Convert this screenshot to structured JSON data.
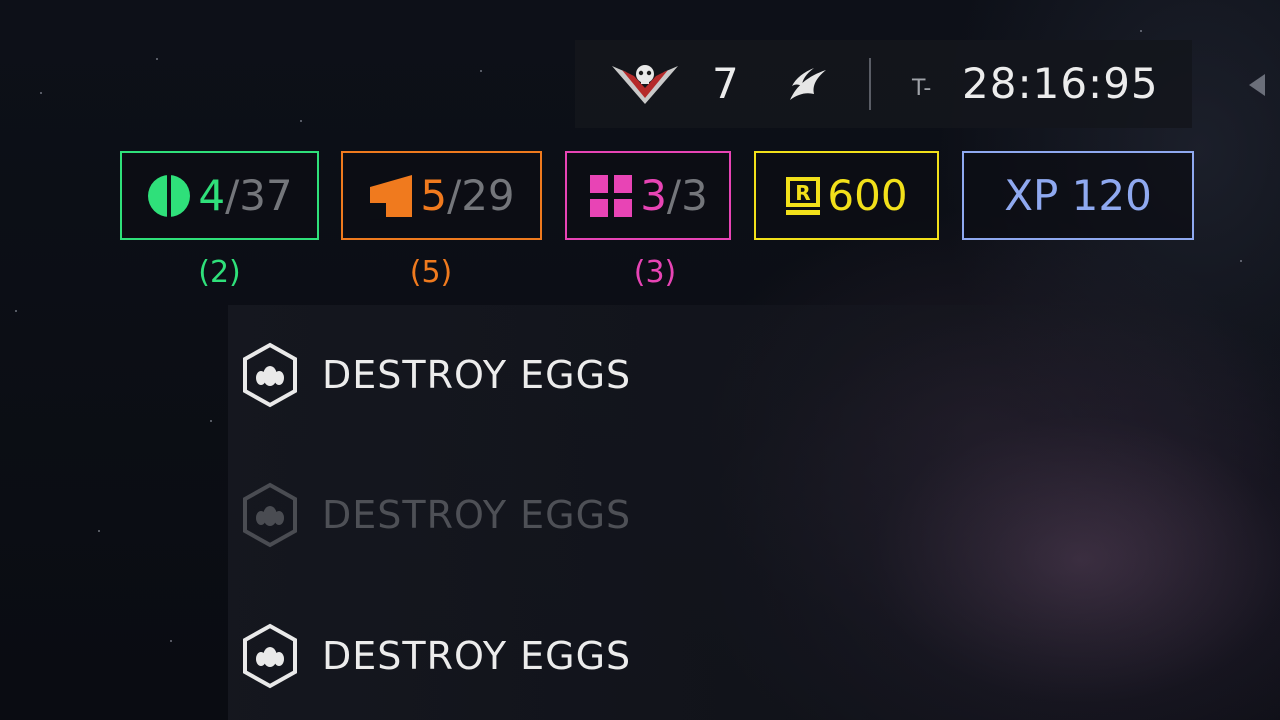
{
  "status_bar": {
    "player_count": "7",
    "timer_prefix": "T-",
    "timer": "28:16:95"
  },
  "resources": [
    {
      "id": "common",
      "current": "4",
      "total": "/37",
      "sub": "(2)",
      "color": "#2fe07a",
      "icon": "common-sample-icon"
    },
    {
      "id": "rare",
      "current": "5",
      "total": "/29",
      "sub": "(5)",
      "color": "#f07a1e",
      "icon": "rare-sample-icon"
    },
    {
      "id": "super",
      "current": "3",
      "total": "/3",
      "sub": "(3)",
      "color": "#e844b5",
      "icon": "super-sample-icon"
    },
    {
      "id": "requisition",
      "value": "600",
      "color": "#f2e01a",
      "icon": "requisition-icon"
    },
    {
      "id": "xp",
      "value": "XP 120",
      "color": "#8fa9f0"
    }
  ],
  "objectives": [
    {
      "label": "DESTROY EGGS",
      "state": "active"
    },
    {
      "label": "DESTROY EGGS",
      "state": "dimmed"
    },
    {
      "label": "DESTROY EGGS",
      "state": "active"
    }
  ]
}
